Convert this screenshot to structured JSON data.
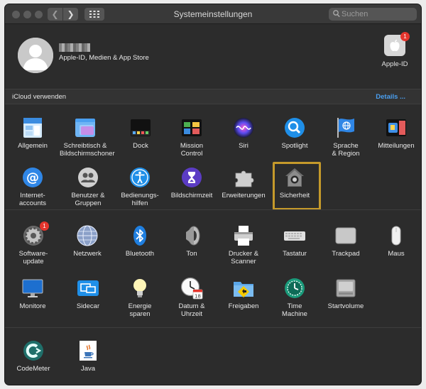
{
  "window": {
    "title": "Systemeinstellungen"
  },
  "search": {
    "placeholder": "Suchen"
  },
  "account": {
    "subtitle": "Apple-ID, Medien & App Store",
    "apple_id_label": "Apple-ID",
    "apple_id_badge": "1"
  },
  "icloud": {
    "label": "iCloud verwenden",
    "details": "Details ..."
  },
  "rows": {
    "r1": [
      {
        "label": "Allgemein",
        "icon": "general-icon"
      },
      {
        "label": "Schreibtisch &\nBildschirmschoner",
        "icon": "desktop-icon"
      },
      {
        "label": "Dock",
        "icon": "dock-icon"
      },
      {
        "label": "Mission\nControl",
        "icon": "mission-control-icon"
      },
      {
        "label": "Siri",
        "icon": "siri-icon"
      },
      {
        "label": "Spotlight",
        "icon": "spotlight-icon"
      },
      {
        "label": "Sprache\n& Region",
        "icon": "language-flag-icon"
      },
      {
        "label": "Mitteilungen",
        "icon": "notifications-icon"
      }
    ],
    "r2": [
      {
        "label": "Internet-\naccounts",
        "icon": "at-icon"
      },
      {
        "label": "Benutzer &\nGruppen",
        "icon": "users-icon"
      },
      {
        "label": "Bedienungs-\nhilfen",
        "icon": "accessibility-icon"
      },
      {
        "label": "Bildschirmzeit",
        "icon": "hourglass-icon"
      },
      {
        "label": "Erweiterungen",
        "icon": "puzzle-icon"
      },
      {
        "label": "Sicherheit",
        "icon": "security-house-icon"
      }
    ],
    "r3": [
      {
        "label": "Software-\nupdate",
        "icon": "gear-icon",
        "badge": "1"
      },
      {
        "label": "Netzwerk",
        "icon": "globe-icon"
      },
      {
        "label": "Bluetooth",
        "icon": "bluetooth-icon"
      },
      {
        "label": "Ton",
        "icon": "speaker-icon"
      },
      {
        "label": "Drucker &\nScanner",
        "icon": "printer-icon"
      },
      {
        "label": "Tastatur",
        "icon": "keyboard-icon"
      },
      {
        "label": "Trackpad",
        "icon": "trackpad-icon"
      },
      {
        "label": "Maus",
        "icon": "mouse-icon"
      }
    ],
    "r4": [
      {
        "label": "Monitore",
        "icon": "monitor-icon"
      },
      {
        "label": "Sidecar",
        "icon": "sidecar-icon"
      },
      {
        "label": "Energie\nsparen",
        "icon": "lightbulb-icon"
      },
      {
        "label": "Datum &\nUhrzeit",
        "icon": "clock-icon"
      },
      {
        "label": "Freigaben",
        "icon": "sharing-folder-icon"
      },
      {
        "label": "Time\nMachine",
        "icon": "time-machine-icon"
      },
      {
        "label": "Startvolume",
        "icon": "disk-icon"
      }
    ],
    "r5": [
      {
        "label": "CodeMeter",
        "icon": "codemeter-icon"
      },
      {
        "label": "Java",
        "icon": "java-icon"
      }
    ]
  },
  "calendar_day": "18",
  "colors": {
    "accent": "#4a9ff0",
    "highlight": "#c59a2b",
    "badge": "#e5352d"
  }
}
